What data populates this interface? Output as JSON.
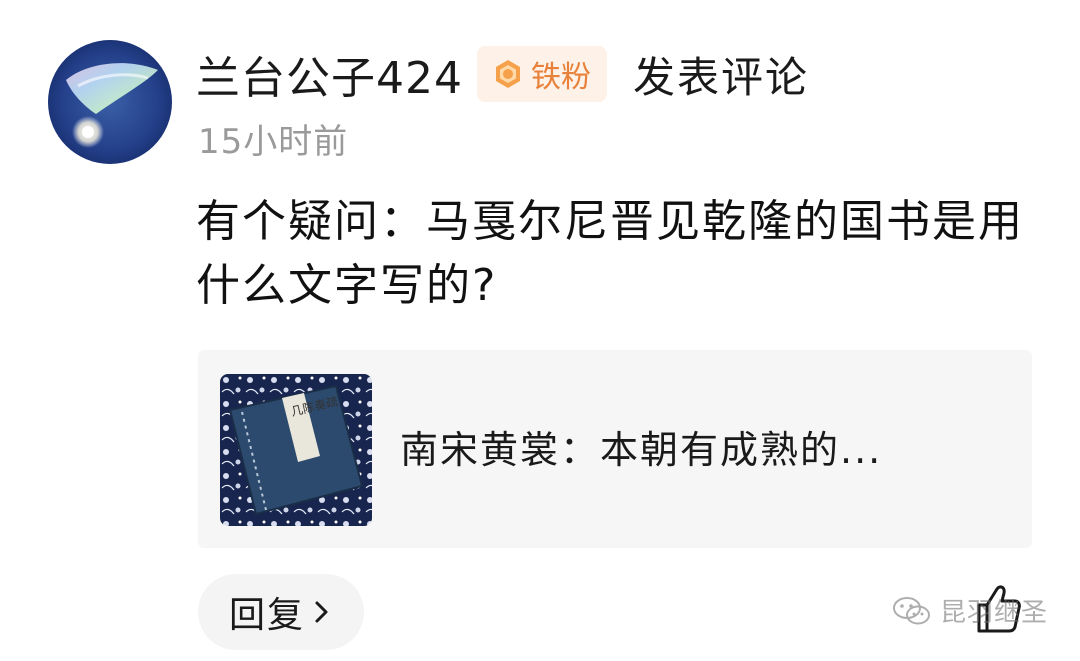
{
  "comment": {
    "author": "兰台公子424",
    "badge": {
      "label": "铁粉",
      "icon": "fan-badge-icon",
      "color": "#e8823a"
    },
    "action": "发表评论",
    "time": "15小时前",
    "text": "有个疑问：马戛尔尼晋见乾隆的国书是用什么文字写的?",
    "linked_post": {
      "thumbnail": "book-cover-thumbnail",
      "thumbnail_title": "几陈奏疏",
      "title": "南宋黄裳：本朝有成熟的..."
    },
    "reply": {
      "label": "回复"
    }
  },
  "watermark": {
    "text": "昆羽继圣",
    "icon": "wechat-icon"
  }
}
